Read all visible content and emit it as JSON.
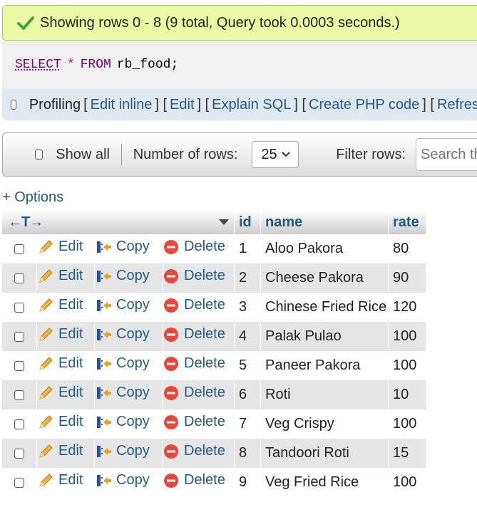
{
  "message": {
    "text": "Showing rows 0 - 8 (9 total, Query took 0.0003 seconds.)",
    "icon": "check-icon"
  },
  "sql": {
    "select": "SELECT",
    "star": "*",
    "from": "FROM",
    "table": "rb_food;"
  },
  "profiling": {
    "label": "Profiling",
    "links": [
      "Edit inline",
      "Edit",
      "Explain SQL",
      "Create PHP code",
      "Refresh"
    ]
  },
  "navigation": {
    "show_all": "Show all",
    "number_of_rows_label": "Number of rows:",
    "number_of_rows_value": "25",
    "filter_label": "Filter rows:",
    "search_placeholder": "Search this table"
  },
  "options_link": "+ Options",
  "table": {
    "arrows": "←T→",
    "columns": [
      "id",
      "name",
      "rate"
    ],
    "action_labels": {
      "edit": "Edit",
      "copy": "Copy",
      "delete": "Delete"
    },
    "rows": [
      {
        "id": "1",
        "name": "Aloo Pakora",
        "rate": "80"
      },
      {
        "id": "2",
        "name": "Cheese Pakora",
        "rate": "90"
      },
      {
        "id": "3",
        "name": "Chinese Fried Rice",
        "rate": "120"
      },
      {
        "id": "4",
        "name": "Palak Pulao",
        "rate": "100"
      },
      {
        "id": "5",
        "name": "Paneer Pakora",
        "rate": "100"
      },
      {
        "id": "6",
        "name": "Roti",
        "rate": "10"
      },
      {
        "id": "7",
        "name": "Veg Crispy",
        "rate": "100"
      },
      {
        "id": "8",
        "name": "Tandoori Roti",
        "rate": "15"
      },
      {
        "id": "9",
        "name": "Veg Fried Rice",
        "rate": "100"
      }
    ]
  },
  "colors": {
    "link": "#235a81",
    "success_bg": "#ebf8a4",
    "row_even": "#e5e5e5",
    "sql_keyword": "#770088"
  }
}
